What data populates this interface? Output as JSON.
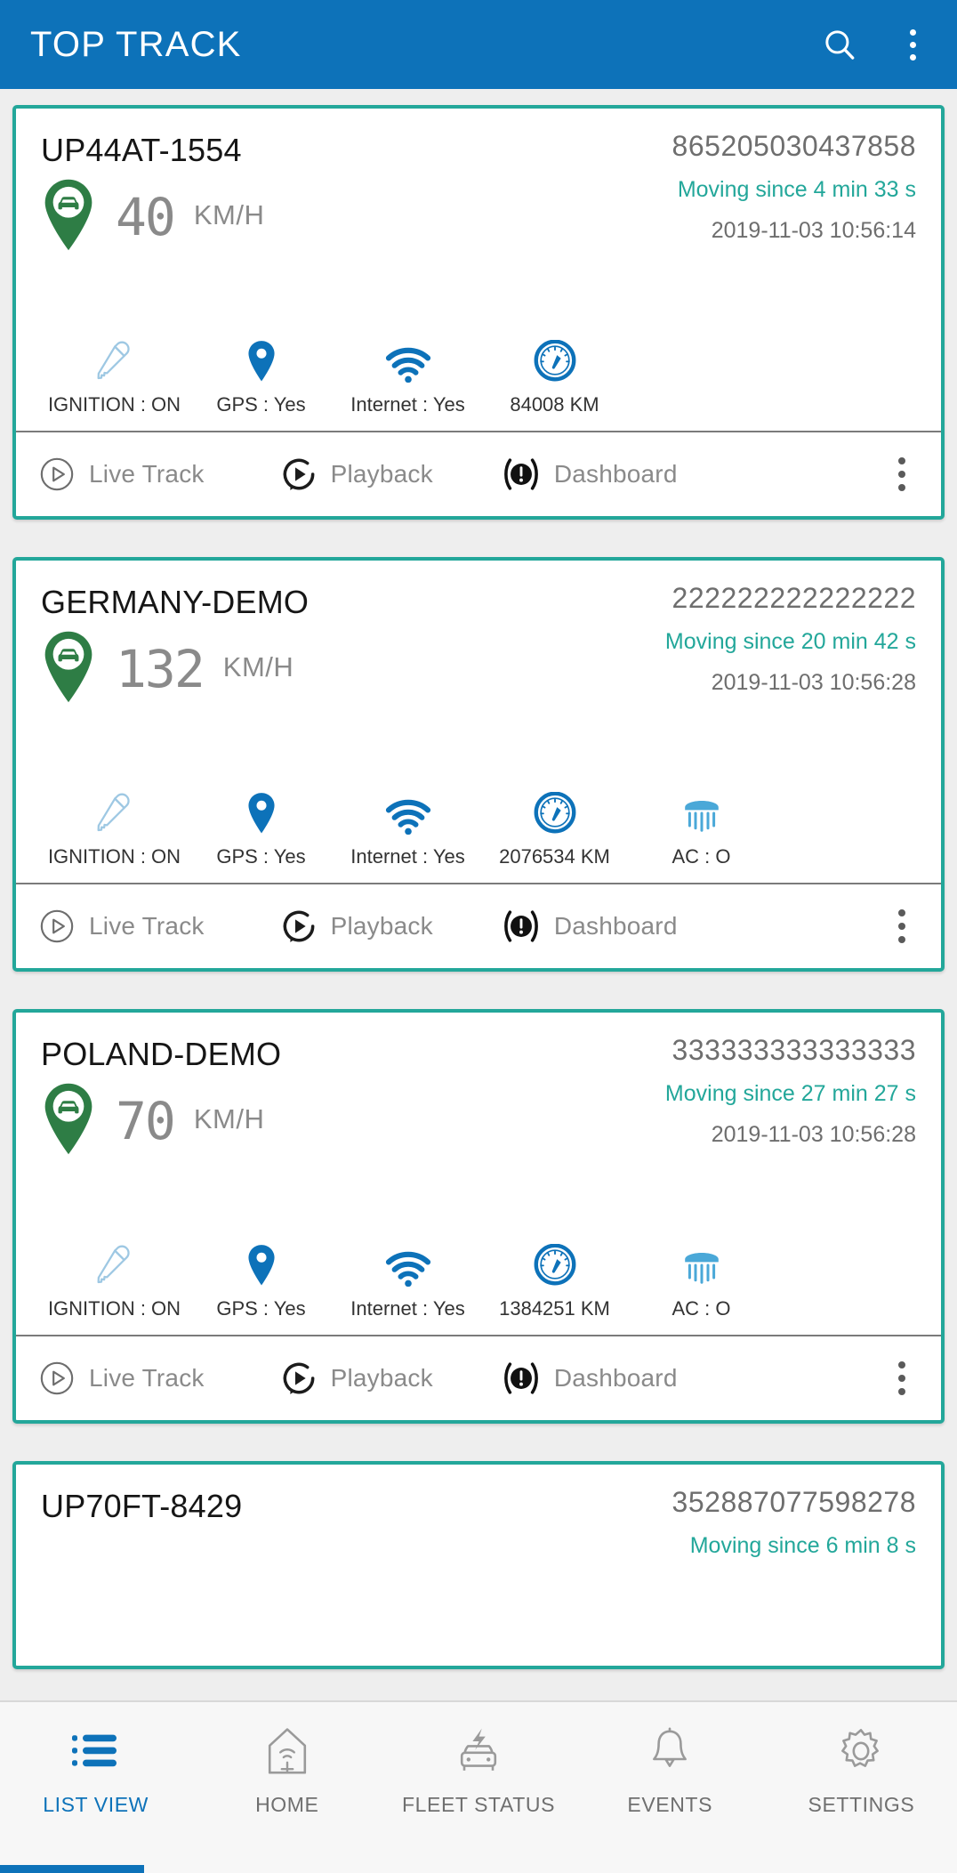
{
  "appbar": {
    "title": "TOP TRACK",
    "search_icon": "search-icon",
    "overflow_icon": "overflow-menu-icon"
  },
  "actions": {
    "live_track": "Live Track",
    "playback": "Playback",
    "dashboard": "Dashboard",
    "overflow": "card-overflow-menu"
  },
  "units": {
    "speed": "KM/H"
  },
  "cards": [
    {
      "name": "UP44AT-1554",
      "imei": "865205030437858",
      "moving": "Moving since 4 min 33 s",
      "timestamp": "2019-11-03 10:56:14",
      "speed": "40",
      "stats": [
        {
          "icon": "key-icon",
          "label": "IGNITION : ON"
        },
        {
          "icon": "gps-pin-icon",
          "label": "GPS : Yes"
        },
        {
          "icon": "wifi-icon",
          "label": "Internet : Yes"
        },
        {
          "icon": "odometer-icon",
          "label": "84008 KM"
        }
      ]
    },
    {
      "name": "GERMANY-DEMO",
      "imei": "222222222222222",
      "moving": "Moving since 20 min 42 s",
      "timestamp": "2019-11-03 10:56:28",
      "speed": "132",
      "stats": [
        {
          "icon": "key-icon",
          "label": "IGNITION : ON"
        },
        {
          "icon": "gps-pin-icon",
          "label": "GPS : Yes"
        },
        {
          "icon": "wifi-icon",
          "label": "Internet : Yes"
        },
        {
          "icon": "odometer-icon",
          "label": "2076534 KM"
        },
        {
          "icon": "ac-icon",
          "label": "AC : O"
        }
      ]
    },
    {
      "name": "POLAND-DEMO",
      "imei": "333333333333333",
      "moving": "Moving since 27 min 27 s",
      "timestamp": "2019-11-03 10:56:28",
      "speed": "70",
      "stats": [
        {
          "icon": "key-icon",
          "label": "IGNITION : ON"
        },
        {
          "icon": "gps-pin-icon",
          "label": "GPS : Yes"
        },
        {
          "icon": "wifi-icon",
          "label": "Internet : Yes"
        },
        {
          "icon": "odometer-icon",
          "label": "1384251 KM"
        },
        {
          "icon": "ac-icon",
          "label": "AC : O"
        }
      ]
    },
    {
      "name": "UP70FT-8429",
      "imei": "352887077598278",
      "moving": "Moving since 6 min 8 s",
      "timestamp": "",
      "speed": "",
      "stats": []
    }
  ],
  "bottomnav": [
    {
      "icon": "list-icon",
      "label": "LIST VIEW",
      "active": true
    },
    {
      "icon": "home-icon",
      "label": "HOME",
      "active": false
    },
    {
      "icon": "fleet-icon",
      "label": "FLEET STATUS",
      "active": false
    },
    {
      "icon": "bell-icon",
      "label": "EVENTS",
      "active": false
    },
    {
      "icon": "gear-icon",
      "label": "SETTINGS",
      "active": false
    }
  ],
  "colors": {
    "appbar": "#0d72b9",
    "card_border": "#23a79a",
    "accent_teal": "#23a79a",
    "icon_blue": "#0d72b9",
    "pin_green": "#2e7d45"
  }
}
